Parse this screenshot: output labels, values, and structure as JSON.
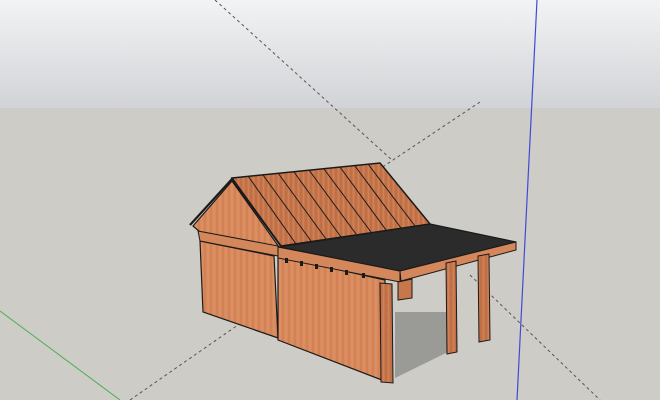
{
  "viewport": {
    "sky_top_color": "#f2f3f5",
    "sky_bottom_color": "#d2d3d6",
    "ground_color": "#cdccc6",
    "axis_blue_color": "#3f4bd6",
    "axis_green_color": "#4caf50",
    "guide_line_color": "#555555"
  },
  "model": {
    "wood_light_color": "#d98a5c",
    "wood_dark_color": "#b9673f",
    "roof_metal_color": "#c8774c",
    "flat_roof_color": "#2b2b2b",
    "shadow_color": "#9a9a96",
    "edge_color": "#1a1a1a"
  }
}
